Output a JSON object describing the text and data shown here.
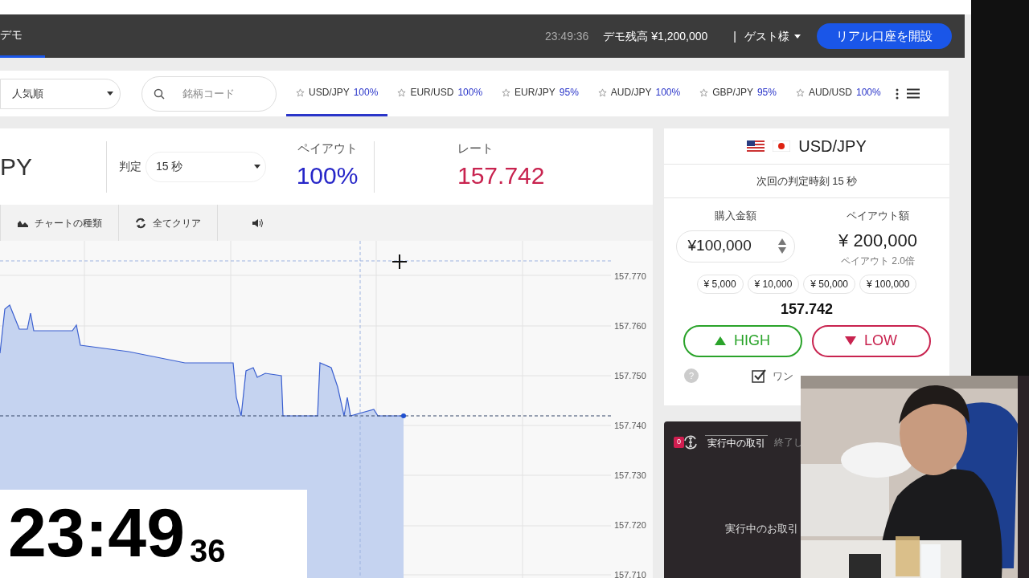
{
  "header": {
    "tab": "デモ",
    "time": "23:49:36",
    "balance": "デモ残高 ¥1,200,000",
    "separator": "|",
    "user": "ゲスト様",
    "open_account": "リアル口座を開設"
  },
  "toolbar": {
    "sort": "人気順",
    "search_placeholder": "銘柄コード",
    "pairs": [
      {
        "name": "USD/JPY",
        "payout": "100%",
        "selected": true
      },
      {
        "name": "EUR/USD",
        "payout": "100%",
        "selected": false
      },
      {
        "name": "EUR/JPY",
        "payout": "95%",
        "selected": false
      },
      {
        "name": "AUD/JPY",
        "payout": "100%",
        "selected": false
      },
      {
        "name": "GBP/JPY",
        "payout": "95%",
        "selected": false
      },
      {
        "name": "AUD/USD",
        "payout": "100%",
        "selected": false
      }
    ]
  },
  "info": {
    "symbol": "PY",
    "judge_label": "判定",
    "judge_value": "15 秒",
    "payout_label": "ペイアウト",
    "payout": "100%",
    "rate_label": "レート",
    "rate": "157.742"
  },
  "chart_tools": [
    {
      "kind": "chart-type",
      "label": "チャートの種類"
    },
    {
      "kind": "clear",
      "label": "全てクリア"
    },
    {
      "kind": "sound"
    }
  ],
  "chart": {
    "y_labels": [
      "157.770",
      "157.760",
      "157.750",
      "157.740",
      "157.730",
      "157.720",
      "157.710"
    ]
  },
  "order": {
    "pair": "USD/JPY",
    "next": "次回の判定時刻 15 秒",
    "amount_label": "購入金額",
    "payout_label": "ペイアウト額",
    "amount": "¥100,000",
    "payout": "¥ 200,000",
    "multiplier": "ペイアウト 2.0倍",
    "presets": [
      "¥ 5,000",
      "¥ 10,000",
      "¥ 50,000",
      "¥ 100,000"
    ],
    "rate": "157.742",
    "high": "HIGH",
    "low": "LOW",
    "help": "?",
    "one_click": {
      "label": "ワン",
      "checked": true
    }
  },
  "trades": {
    "count": "0",
    "tabs": [
      {
        "label": "実行中の取引",
        "selected": true
      },
      {
        "label": "終了し",
        "selected": false
      }
    ],
    "empty": "実行中のお取引"
  },
  "clock": {
    "hm": "23:49",
    "s": "36"
  }
}
